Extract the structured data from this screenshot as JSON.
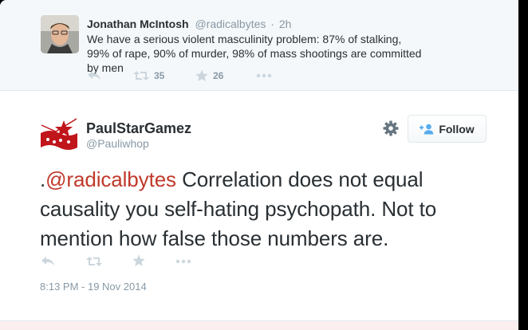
{
  "parent_tweet": {
    "name": "Jonathan McIntosh",
    "handle": "@radicalbytes",
    "separator": "·",
    "time": "2h",
    "text": "We have a serious violent masculinity problem: 87% of stalking, 99% of rape, 90% of murder, 98% of mass shootings are committed by men",
    "retweet_count": "35",
    "favorite_count": "26"
  },
  "main_tweet": {
    "name": "PaulStarGamez",
    "handle": "@Pauliwhop",
    "mention": "@radicalbytes",
    "lead_char": ".",
    "text_after_mention": " Correlation does not equal causality you self-hating psychopath.  Not to mention how false those numbers are.",
    "timestamp": "8:13 PM - 19 Nov 2014",
    "follow_label": "Follow"
  },
  "icons": {
    "reply": "reply-icon",
    "retweet": "retweet-icon",
    "favorite": "star-icon",
    "more": "more-icon",
    "settings": "gear-icon",
    "follow": "add-person-icon"
  },
  "colors": {
    "mention": "#c0392b",
    "action_icon": "#ccd6dd",
    "meta_text": "#8899a6",
    "body_text": "#292f33"
  }
}
